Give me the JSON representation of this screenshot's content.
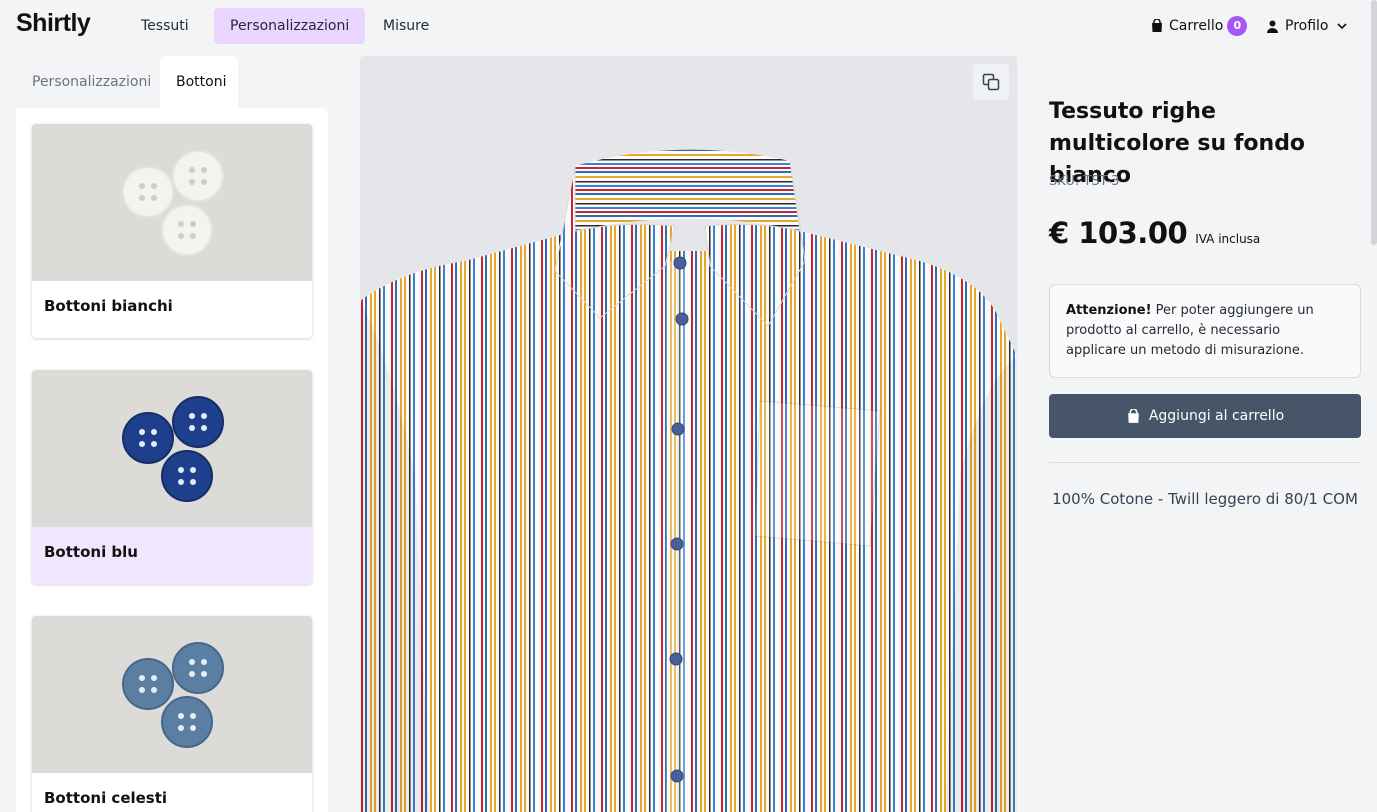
{
  "header": {
    "logo": "Shirtly",
    "nav": [
      "Tessuti",
      "Personalizzazioni",
      "Misure"
    ],
    "cart_label": "Carrello",
    "cart_count": "0",
    "profile_label": "Profilo"
  },
  "left_panel": {
    "tabs": [
      "Personalizzazioni",
      "Bottoni"
    ],
    "active_tab": "Bottoni",
    "options": [
      {
        "label": "Bottoni bianchi",
        "color": "#f4f3f0",
        "selected": false
      },
      {
        "label": "Bottoni blu",
        "color": "#1e3f8c",
        "selected": true
      },
      {
        "label": "Bottoni celesti",
        "color": "#5b7fa3",
        "selected": false
      }
    ]
  },
  "viewer": {
    "toggle_icon": "copy-view-icon",
    "shirt_stripe_colors": [
      "#c8262d",
      "#2f6bbd",
      "#e8a62c",
      "#2a2a2a",
      "#3d7fd0"
    ]
  },
  "product": {
    "title": "Tessuto righe multicolore su fondo bianco",
    "sku": "SKU: TST-3",
    "price": "€ 103.00",
    "vat": "IVA inclusa",
    "alert_strong": "Attenzione!",
    "alert_text": "Per poter aggiungere un prodotto al carrello, è necessario applicare un metodo di misurazione.",
    "add_to_cart": "Aggiungi al carrello",
    "fabric_info": "100% Cotone - Twill leggero di 80/1 COM"
  },
  "colors": {
    "accent": "#a855f7",
    "nav_active_bg": "#e9d5ff",
    "button_bg": "#475569"
  }
}
